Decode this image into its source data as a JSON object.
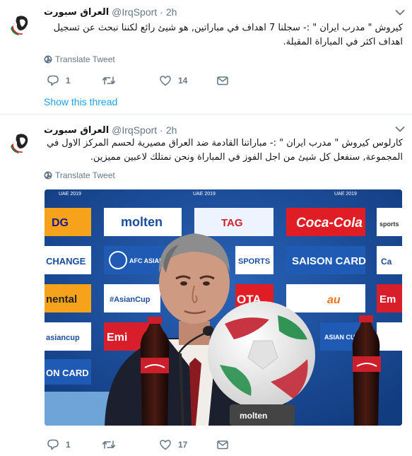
{
  "tweets": [
    {
      "name": "العراق سبورت",
      "handle": "@IrqSport",
      "dot": "·",
      "time": "2h",
      "text": "كيروش \" مدرب ايران \" :- سجلنا 7 اهداف في مباراتين, هو شيئ رائع لكننا نبحث عن تسجيل اهداف اكثر في المباراة المقبلة.",
      "translate_label": "Translate Tweet",
      "replies": "1",
      "retweets": "",
      "likes": "14",
      "show_thread": "Show this thread"
    },
    {
      "name": "العراق سبورت",
      "handle": "@IrqSport",
      "dot": "·",
      "time": "2h",
      "text": "كارلوس كيروش \" مدرب ايران \" :- مباراتنا القادمة ضد العراق مصيرية لحسم المركز الاول في المجموعة, سنفعل كل شيئ من اجل الفوز في المباراة ونحن نمتلك لاعبين مميزين.",
      "translate_label": "Translate Tweet",
      "replies": "1",
      "retweets": "",
      "likes": "17",
      "media": {
        "board_texts": [
          "UAE 2019",
          "UAE 2019",
          "UAE 2019",
          "DG",
          "molten",
          "TAG",
          "Coca-Cola",
          "sports",
          "CHANGE",
          "AFC ASIAN CUP",
          "SPORTS",
          "SAISON CARD",
          "Ca",
          "nental",
          "#AsianCup",
          "OTA",
          "au",
          "Em",
          "asiancup",
          "Emi",
          "ASIAN CUP",
          "ON CARD",
          "molten"
        ]
      }
    }
  ],
  "colors": {
    "link": "#1da1f2",
    "muted": "#657786",
    "text": "#14171a",
    "divider": "#e6ecf0",
    "backdrop_blue": "#1a4d9e"
  },
  "icons": [
    "avatar-logo",
    "chevron-down-icon",
    "globe-icon",
    "reply-icon",
    "retweet-icon",
    "heart-icon",
    "mail-icon"
  ]
}
